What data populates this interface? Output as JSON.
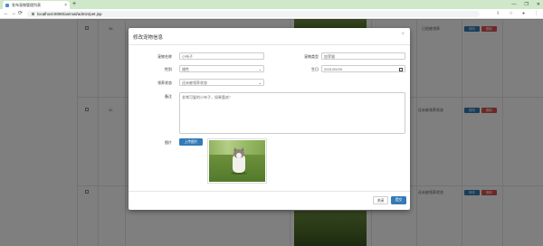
{
  "browser": {
    "tab_title": "发布宠物管理列表",
    "close_glyph": "×",
    "new_tab_glyph": "+",
    "url": "localhost:8080/animal/admin/pet.jsp",
    "back_glyph": "←",
    "forward_glyph": "→",
    "reload_glyph": "⟳",
    "window_buttons": [
      "—",
      "❐",
      "✕"
    ]
  },
  "table": {
    "rows": [
      {
        "id": "26",
        "status": "已经被领养",
        "edit": "修改",
        "delete": "删除"
      },
      {
        "id": "31",
        "status": "还未被领养状态",
        "edit": "修改",
        "delete": "删除"
      },
      {
        "id": "",
        "status": "还未被领养状态",
        "edit": "修改",
        "delete": "删除"
      }
    ]
  },
  "modal": {
    "title": "修改宠物信息",
    "close_glyph": "×",
    "fields": {
      "name_label": "宠物名称",
      "name_value": "小布子",
      "type_label": "宠物类型",
      "type_value": "加菲猫",
      "gender_label": "性别",
      "gender_value": "雄性",
      "birthday_label": "生日",
      "birthday_value": "2021/09/29",
      "adopt_label": "领养状态",
      "adopt_value": "还未被领养状态",
      "remark_label": "备注",
      "remark_value": "非常可爱的小布子，如果喜欢！",
      "image_label": "图片",
      "upload_label": "上传图片"
    },
    "buttons": {
      "close": "关闭",
      "submit": "提交"
    }
  }
}
